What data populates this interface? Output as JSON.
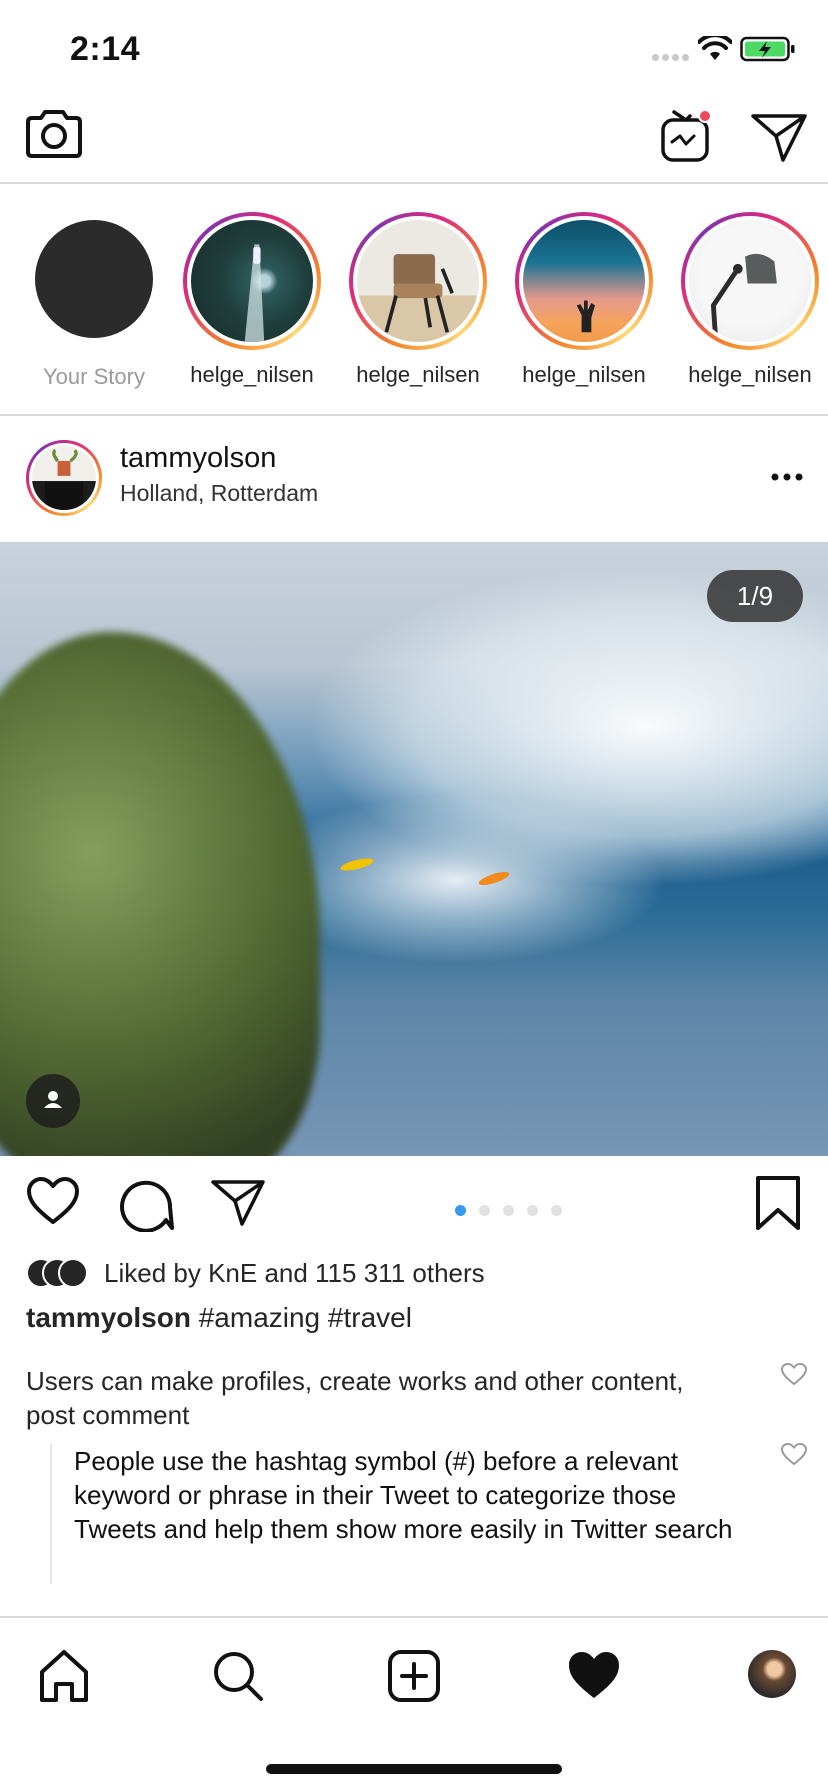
{
  "status_bar": {
    "time": "2:14"
  },
  "stories": [
    {
      "label": "Your Story",
      "own": true
    },
    {
      "label": "helge_nilsen",
      "photo": "ocean-aerial"
    },
    {
      "label": "helge_nilsen",
      "photo": "chair"
    },
    {
      "label": "helge_nilsen",
      "photo": "sunset-hand"
    },
    {
      "label": "helge_nilsen",
      "photo": "desk-lamp"
    }
  ],
  "post": {
    "username": "tammyolson",
    "location": "Holland, Rotterdam",
    "page_counter": "1/9",
    "carousel": {
      "count": 5,
      "active": 0
    },
    "likes": {
      "prefix": "Liked by",
      "text": "KnE and 115 311 others"
    },
    "caption": {
      "user": "tammyolson",
      "text": "#amazing #travel"
    },
    "comments": [
      {
        "text": "Users can make profiles, create works and other content, post comment"
      },
      {
        "text": "People use the hashtag symbol (#) before a relevant keyword or phrase in their Tweet to categorize those Tweets and help them show more easily in Twitter search"
      }
    ]
  },
  "colors": {
    "accent": "#3897f0",
    "ring_start": "#f58529",
    "ring_mid": "#dd2a7b",
    "ring_end": "#8134af"
  },
  "tab_bar": [
    "home-icon",
    "search-icon",
    "add-post-icon",
    "activity-heart-icon",
    "profile-avatar"
  ]
}
